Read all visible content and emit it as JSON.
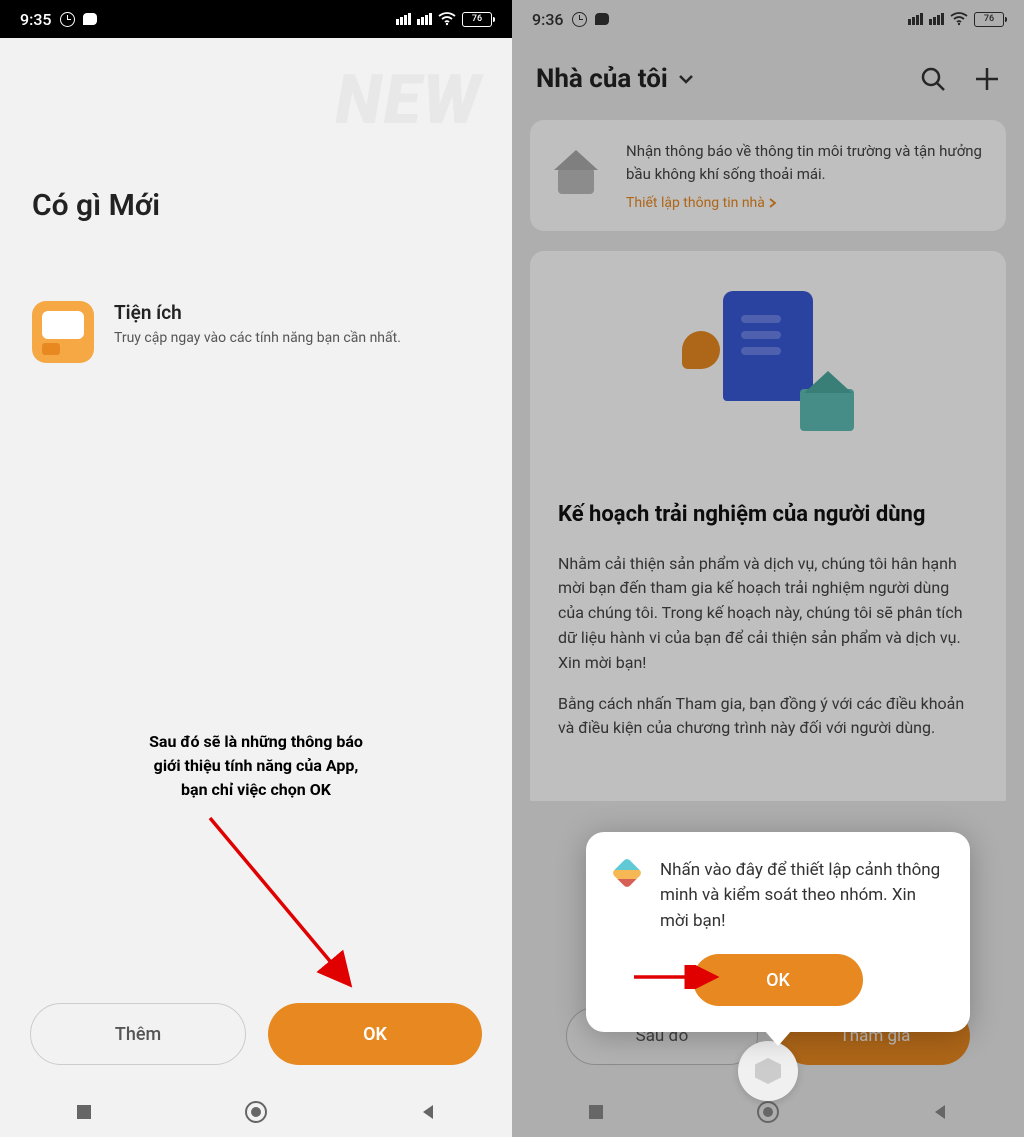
{
  "left": {
    "status": {
      "time": "9:35",
      "battery": "76"
    },
    "watermark": "NEW",
    "title": "Có gì Mới",
    "feature": {
      "title": "Tiện ích",
      "desc": "Truy cập ngay vào các tính năng bạn cần nhất."
    },
    "annotation_l1": "Sau đó sẽ là những thông báo",
    "annotation_l2": "giới thiệu tính năng của App,",
    "annotation_l3": "bạn chỉ việc chọn OK",
    "btn_more": "Thêm",
    "btn_ok": "OK"
  },
  "right": {
    "status": {
      "time": "9:36",
      "battery": "76"
    },
    "header": "Nhà của tôi",
    "info_text": "Nhận thông báo về thông tin môi trường và tận hưởng bầu không khí sống thoải mái.",
    "info_link": "Thiết lập thông tin nhà",
    "plan_title": "Kế hoạch trải nghiệm của người dùng",
    "plan_text": "Nhằm cải thiện sản phẩm và dịch vụ, chúng tôi hân hạnh mời bạn đến tham gia kế hoạch trải nghiệm người dùng của chúng tôi. Trong kế hoạch này, chúng tôi sẽ phân tích dữ liệu hành vi của bạn để cải thiện sản phẩm và dịch vụ. Xin mời bạn!",
    "plan_text2": "Bằng cách nhấn Tham gia, bạn đồng ý với các điều khoản và điều kiện của chương trình này đối với người dùng.",
    "popup_text": "Nhấn vào đây để thiết lập cảnh thông minh và kiểm soát theo nhóm. Xin mời bạn!",
    "popup_ok": "OK",
    "btn_later": "Sau đó",
    "btn_join": "Tham gia"
  }
}
